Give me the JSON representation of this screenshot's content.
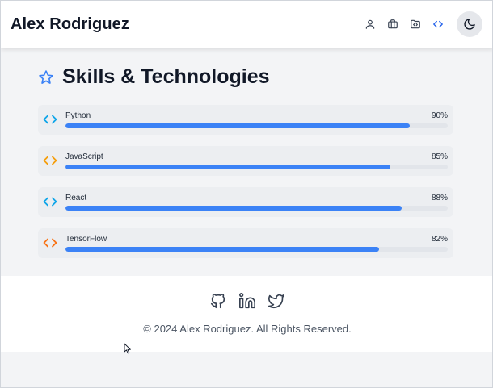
{
  "header": {
    "brand": "Alex Rodriguez",
    "nav": [
      {
        "icon": "user-icon"
      },
      {
        "icon": "briefcase-icon"
      },
      {
        "icon": "folder-code-icon"
      },
      {
        "icon": "code-icon"
      }
    ],
    "theme_toggle_icon": "moon-icon"
  },
  "main": {
    "title": "Skills & Technologies",
    "title_icon": "star-icon",
    "accent": "#3b82f6",
    "skills": [
      {
        "name": "Python",
        "percent_label": "90%",
        "level": 0.9,
        "icon_color": "#0ea5e9"
      },
      {
        "name": "JavaScript",
        "percent_label": "85%",
        "level": 0.85,
        "icon_color": "#f59e0b"
      },
      {
        "name": "React",
        "percent_label": "88%",
        "level": 0.88,
        "icon_color": "#0ea5e9"
      },
      {
        "name": "TensorFlow",
        "percent_label": "82%",
        "level": 0.82,
        "icon_color": "#f97316"
      }
    ]
  },
  "footer": {
    "socials": [
      {
        "icon": "github-icon"
      },
      {
        "icon": "linkedin-icon"
      },
      {
        "icon": "twitter-icon"
      }
    ],
    "copyright": "© 2024 Alex Rodriguez. All Rights Reserved."
  }
}
